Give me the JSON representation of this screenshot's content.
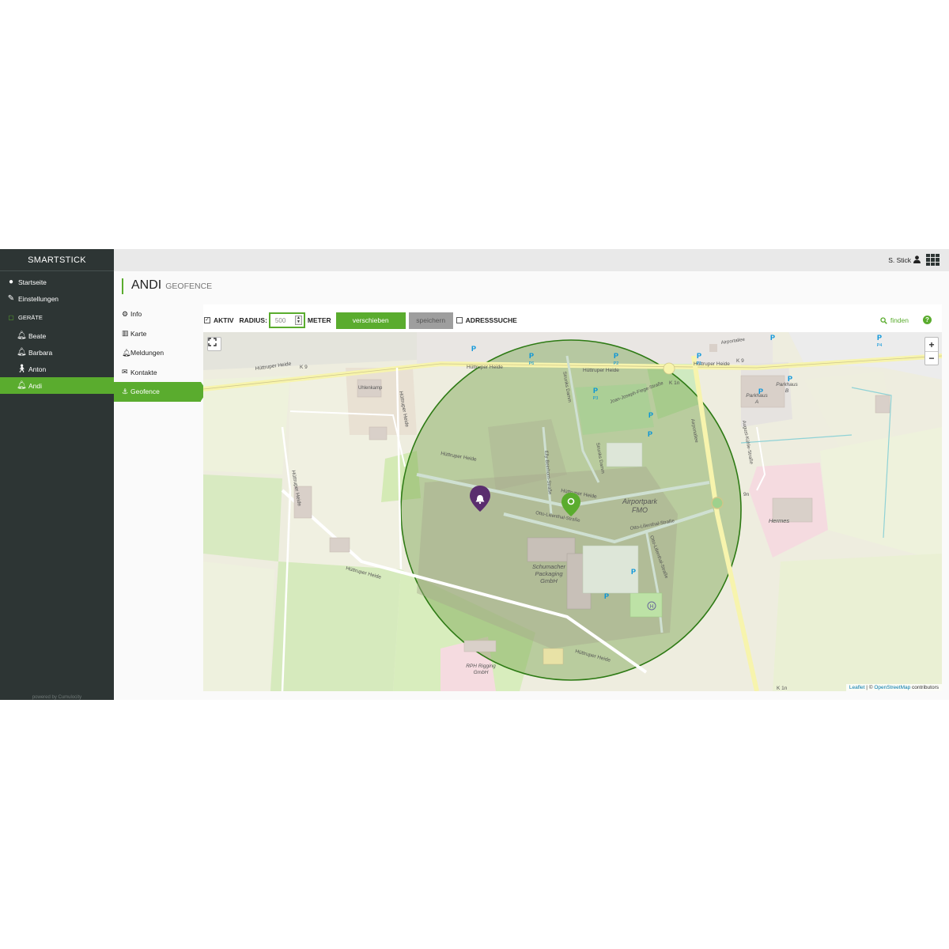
{
  "sidebar": {
    "brand": "SMARTSTICK",
    "nav": [
      {
        "label": "Startseite",
        "icon": "globe-icon"
      },
      {
        "label": "Einstellungen",
        "icon": "wrench-icon"
      }
    ],
    "section_label": "GERÄTE",
    "devices": [
      {
        "label": "Beate",
        "icon": "bell-icon"
      },
      {
        "label": "Barbara",
        "icon": "bell-icon"
      },
      {
        "label": "Anton",
        "icon": "walker-icon"
      },
      {
        "label": "Andi",
        "icon": "bell-icon",
        "active": true
      }
    ],
    "powered": "powered by Cumulocity"
  },
  "header": {
    "user": "S. Stick",
    "user_icon": "user-icon",
    "apps_icon": "app-grid-icon"
  },
  "page": {
    "title": "ANDI",
    "subtitle": "GEOFENCE"
  },
  "subnav": [
    {
      "label": "Info",
      "icon": "gear-icon"
    },
    {
      "label": "Karte",
      "icon": "map-icon"
    },
    {
      "label": "Meldungen",
      "icon": "bell-icon"
    },
    {
      "label": "Kontakte",
      "icon": "envelope-icon"
    },
    {
      "label": "Geofence",
      "icon": "anchor-icon",
      "active": true
    }
  ],
  "toolbar": {
    "active_checked": true,
    "active_label": "AKTIV",
    "radius_label": "RADIUS:",
    "radius_value": "500",
    "unit_label": "METER",
    "move_label": "verschieben",
    "save_label": "speichern",
    "address_checked": false,
    "address_label": "ADRESSSUCHE",
    "find_label": "finden",
    "help_label": "?"
  },
  "map": {
    "labels": {
      "road_huttruper_top": "Hüttruper Heide",
      "road_huttruper_top2": "Hüttruper Heide",
      "road_huttruper_right": "Hüttruper Heide",
      "road_huttruper_mid": "Hüttruper Heide",
      "road_huttruper_bottom": "Hüttruper Heide",
      "road_huttruper_bottom2": "Hüttruper Heide",
      "road_huttruper_left": "Hüttruper Heide",
      "road_huttruper_vert": "Hüttruper Heide",
      "k9_left": "K 9",
      "k9_right": "K 9",
      "k1n_top": "K 1n",
      "k1n_bottom": "K 1n",
      "k9n": "9n",
      "place_uhlenkamp": "Uhlenkamp",
      "airportpark_1": "Airportpark",
      "airportpark_2": "FMO",
      "schumacher_1": "Schumacher",
      "schumacher_2": "Packaging",
      "schumacher_3": "GmbH",
      "rph_1": "RPH Rigging",
      "rph_2": "GmbH",
      "hermes": "Hermes",
      "parkhaus_a_1": "Parkhaus",
      "parkhaus_a_2": "A",
      "parkhaus_b_1": "Parkhaus",
      "parkhaus_b_2": "B",
      "otto_lilienthal": "Otto-Lilienthal-Straße",
      "otto_lilienthal2": "Otto-Lilienthal-Straße",
      "otto_lilienthal3": "Otto-Lilienthal-Straße",
      "joan_joseph": "Joan-Joseph-Fiege-Straße",
      "elly_beinhorn": "Elly-Beinhorn-Straße",
      "airportallee": "Airportallee",
      "airportallee2": "Airportallee",
      "august_kuehle": "August-Kühle-Straße",
      "strunks_damm": "Strunks Damm",
      "strunks_damm2": "Strunks Damm",
      "p6": "P6",
      "p2": "P2",
      "p1": "P1",
      "p3": "P3",
      "p4": "P4",
      "p_letter": "P",
      "helipad": "H"
    },
    "zoom_in": "+",
    "zoom_out": "−",
    "fullscreen_icon": "fullscreen-icon",
    "marker_user_icon": "bell-marker-icon",
    "marker_center_icon": "geofence-center-icon",
    "attribution_leaflet": "Leaflet",
    "attribution_sep": " | © ",
    "attribution_osm": "OpenStreetMap",
    "attribution_rest": " contributors",
    "colors": {
      "accent": "#5aac2e",
      "fence_fill": "#6fa045",
      "fence_stroke": "#2d7a14",
      "marker_purple": "#5a2d6e"
    }
  }
}
